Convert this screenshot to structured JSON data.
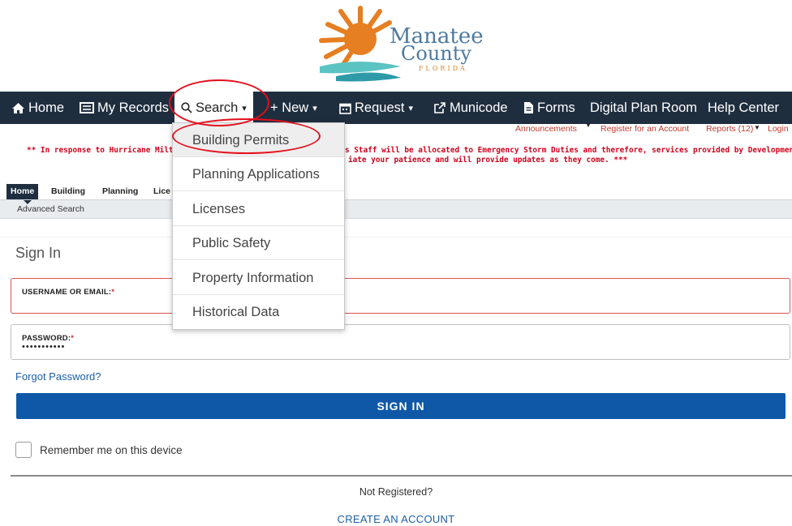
{
  "logo": {
    "line1": "Manatee",
    "line2": "County",
    "line3": "FLORIDA"
  },
  "nav": {
    "home": "Home",
    "my_records": "My Records",
    "search": "Search",
    "new": "+ New",
    "request": "Request",
    "municode": "Municode",
    "forms": "Forms",
    "digital_plan_room": "Digital Plan Room",
    "help_center": "Help Center",
    "caret": "▾"
  },
  "utility": {
    "announcements": "Announcements",
    "register": "Register for an Account",
    "reports": "Reports (12)",
    "login": "Login"
  },
  "alert": {
    "line1_left": "** In response to Hurricane Milton",
    "line1_right": "s Staff will be allocated to Emergency Storm Duties and therefore, services provided by Development",
    "line2": "iate your patience and will provide updates as they come. ***"
  },
  "tabs": [
    "Home",
    "Building",
    "Planning",
    "Lice"
  ],
  "subnav": {
    "advanced_search": "Advanced Search"
  },
  "signin": {
    "title": "Sign In",
    "username_label": "USERNAME OR EMAIL:",
    "username_value": "",
    "password_label": "PASSWORD:",
    "password_value": "•••••••••••",
    "required_mark": "*",
    "forgot": "Forgot Password?",
    "button": "SIGN IN",
    "remember": "Remember me on this device",
    "not_registered": "Not Registered?",
    "create_account": "CREATE AN ACCOUNT"
  },
  "search_menu": {
    "items": [
      "Building Permits",
      "Planning Applications",
      "Licenses",
      "Public Safety",
      "Property Information",
      "Historical Data"
    ]
  },
  "colors": {
    "nav_bg": "#1f2e3f",
    "primary": "#0f58a8",
    "alert": "#d0021b",
    "annotation": "#e3101d"
  }
}
